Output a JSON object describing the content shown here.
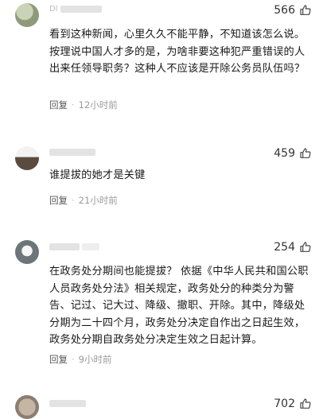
{
  "comments": [
    {
      "likes": "566",
      "text": "看到这种新闻，心里久久不能平静，不知道该怎么说。按理说中国人才多的是，为啥非要这种犯严重错误的人出来任领导职务？这种人不应该是开除公务员队伍吗？",
      "reply_label": "回复",
      "time": "12小时前",
      "username": "Dl"
    },
    {
      "likes": "459",
      "text": "谁提拔的她才是关键",
      "reply_label": "回复",
      "time": "21小时前"
    },
    {
      "likes": "254",
      "text": "在政务处分期间也能提拔？ 依据《中华人民共和国公职人员政务处分法》相关规定，政务处分的种类分为警告、记过、记大过、降级、撤职、开除。其中，降级处分期为二十四个月，政务处分决定自作出之日起生效，政务处分期自政务处分决定生效之日起计算。",
      "reply_label": "回复",
      "time": "9小时前"
    },
    {
      "likes": "702"
    }
  ],
  "colors": {
    "text": "#1a1a1a",
    "meta": "#999999",
    "background": "#ffffff"
  },
  "icons": {
    "like": "thumbs-up-icon"
  }
}
